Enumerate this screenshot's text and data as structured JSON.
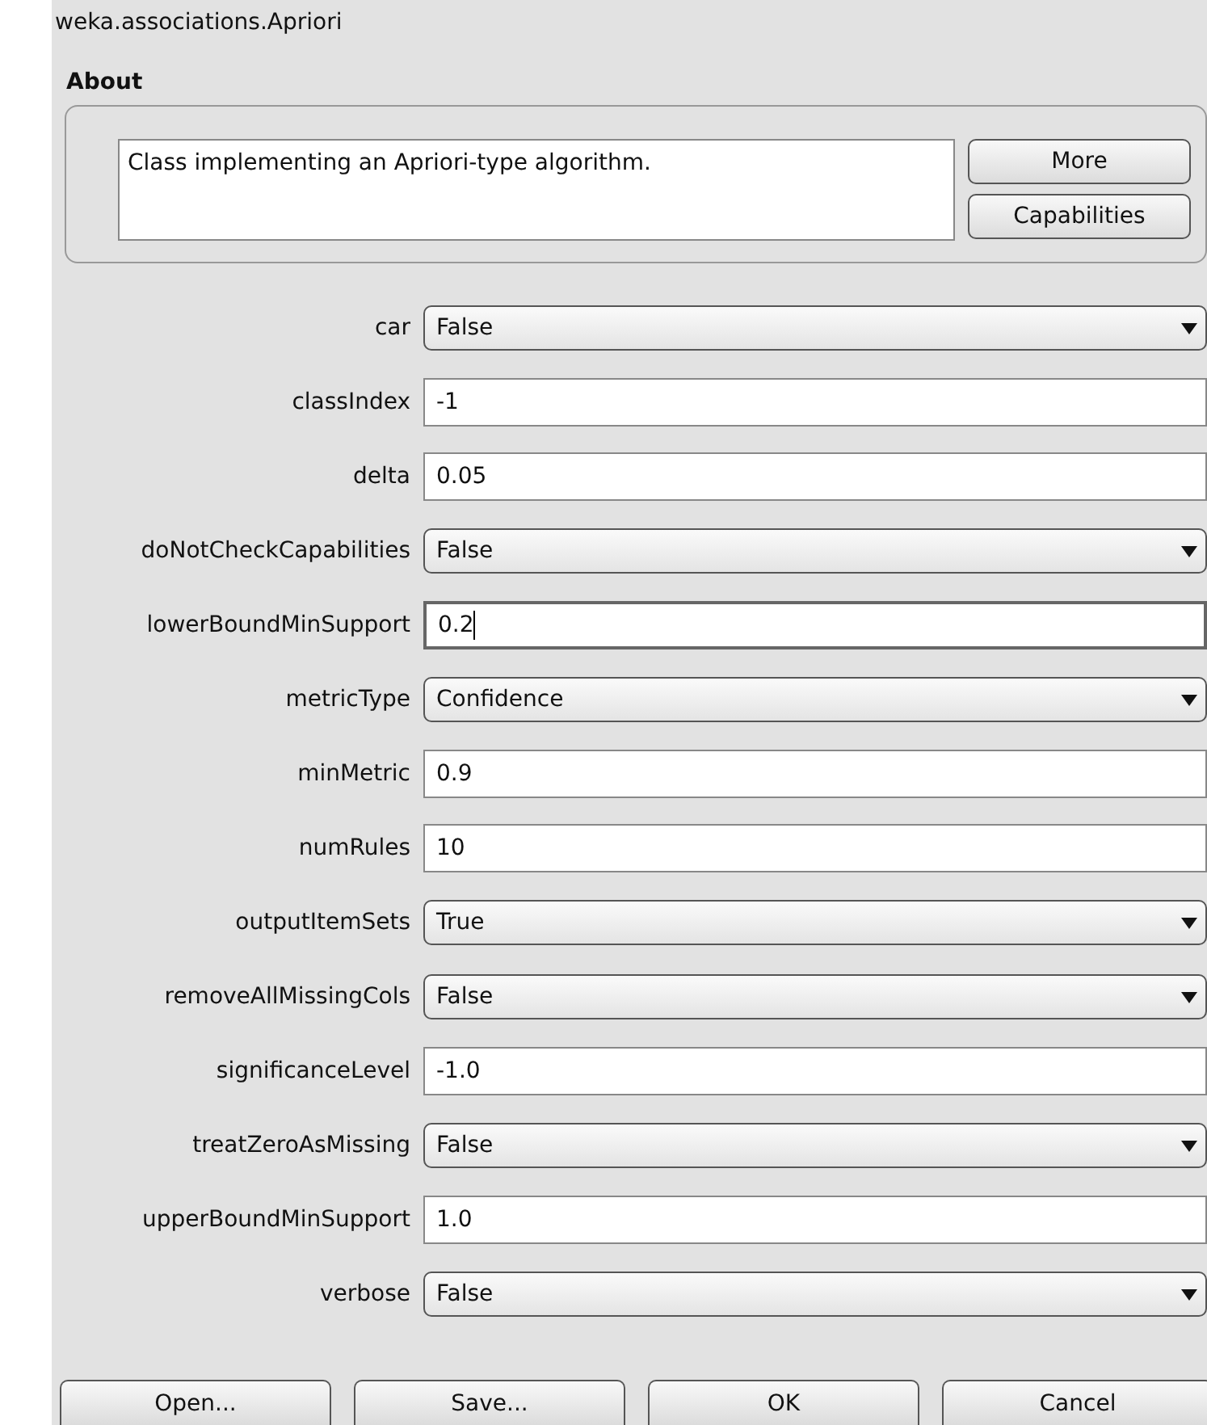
{
  "window": {
    "title": "weka.associations.Apriori"
  },
  "about": {
    "heading": "About",
    "description": "Class implementing an Apriori-type algorithm.",
    "buttons": [
      "More",
      "Capabilities"
    ]
  },
  "properties": [
    {
      "name": "car",
      "kind": "dropdown",
      "value": "False"
    },
    {
      "name": "classIndex",
      "kind": "text",
      "value": "-1",
      "focused": false
    },
    {
      "name": "delta",
      "kind": "text",
      "value": "0.05",
      "focused": false
    },
    {
      "name": "doNotCheckCapabilities",
      "kind": "dropdown",
      "value": "False"
    },
    {
      "name": "lowerBoundMinSupport",
      "kind": "text",
      "value": "0.2",
      "focused": true
    },
    {
      "name": "metricType",
      "kind": "dropdown",
      "value": "Confidence"
    },
    {
      "name": "minMetric",
      "kind": "text",
      "value": "0.9",
      "focused": false
    },
    {
      "name": "numRules",
      "kind": "text",
      "value": "10",
      "focused": false
    },
    {
      "name": "outputItemSets",
      "kind": "dropdown",
      "value": "True"
    },
    {
      "name": "removeAllMissingCols",
      "kind": "dropdown",
      "value": "False"
    },
    {
      "name": "significanceLevel",
      "kind": "text",
      "value": "-1.0",
      "focused": false
    },
    {
      "name": "treatZeroAsMissing",
      "kind": "dropdown",
      "value": "False"
    },
    {
      "name": "upperBoundMinSupport",
      "kind": "text",
      "value": "1.0",
      "focused": false
    },
    {
      "name": "verbose",
      "kind": "dropdown",
      "value": "False"
    }
  ],
  "buttons": [
    "Open...",
    "Save...",
    "OK",
    "Cancel"
  ]
}
